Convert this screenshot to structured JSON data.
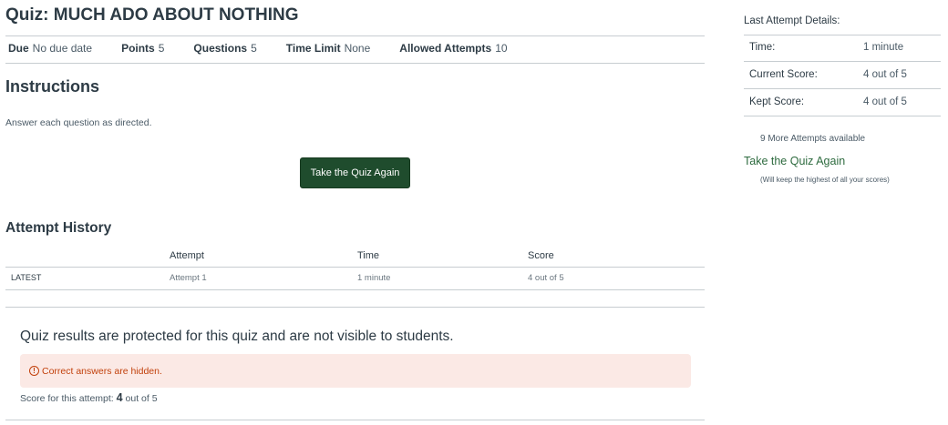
{
  "quiz": {
    "title": "Quiz: MUCH ADO ABOUT NOTHING",
    "details": [
      {
        "label": "Due",
        "value": "No due date"
      },
      {
        "label": "Points",
        "value": "5"
      },
      {
        "label": "Questions",
        "value": "5"
      },
      {
        "label": "Time Limit",
        "value": "None"
      },
      {
        "label": "Allowed Attempts",
        "value": "10"
      }
    ],
    "instructions_heading": "Instructions",
    "instructions_text": "Answer each question as directed.",
    "take_again_button": "Take the Quiz Again"
  },
  "history": {
    "heading": "Attempt History",
    "columns": [
      "Attempt",
      "Time",
      "Score"
    ],
    "rows": [
      {
        "tag": "LATEST",
        "attempt": "Attempt 1",
        "time": "1 minute",
        "score": "4 out of 5"
      }
    ]
  },
  "results": {
    "protected_message": "Quiz results are protected for this quiz and are not visible to students.",
    "alert_icon": "!",
    "alert_text": "Correct answers are hidden.",
    "score_prefix": "Score for this attempt:",
    "score_value": "4",
    "score_suffix": "out of 5"
  },
  "sidebar": {
    "title": "Last Attempt Details:",
    "rows": [
      {
        "label": "Time:",
        "value": "1 minute"
      },
      {
        "label": "Current Score:",
        "value": "4 out of 5"
      },
      {
        "label": "Kept Score:",
        "value": "4 out of 5"
      }
    ],
    "more_attempts": "9 More Attempts available",
    "take_again_link": "Take the Quiz Again",
    "keep_note": "(Will keep the highest of all your scores)"
  }
}
